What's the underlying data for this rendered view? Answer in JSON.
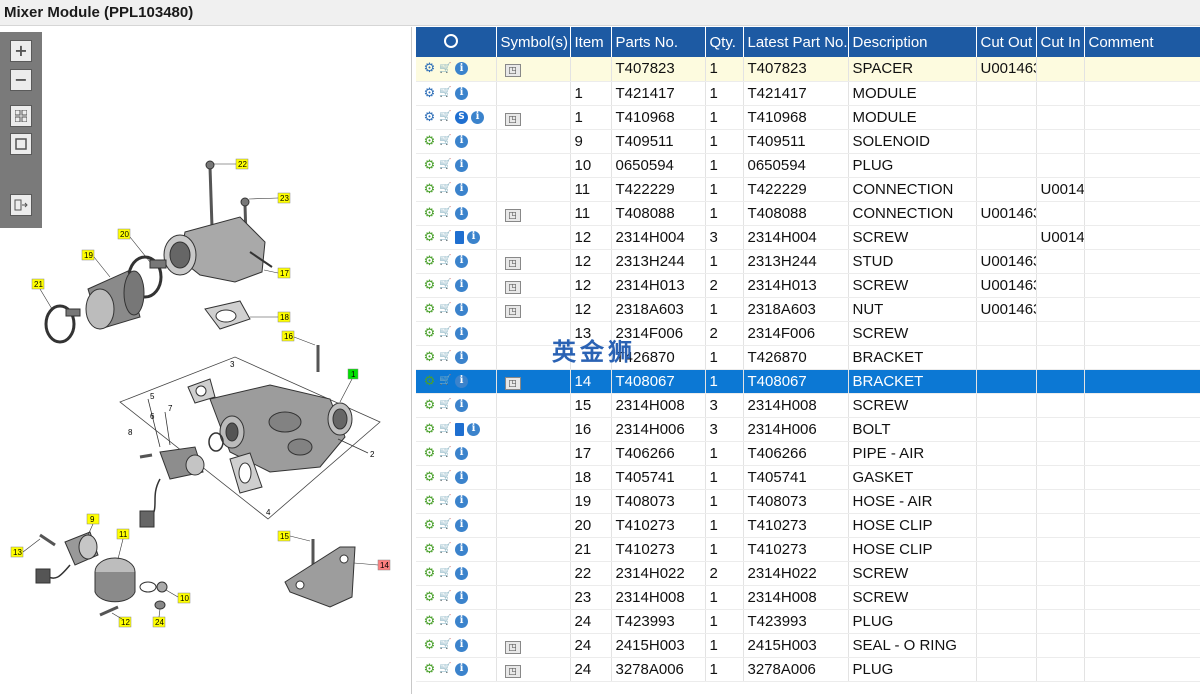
{
  "window": {
    "title": "Mixer Module (PPL103480)"
  },
  "toolbar": {
    "zoom_in_icon": "plus-icon",
    "zoom_out_icon": "minus-icon",
    "fit_icon": "grid-icon",
    "actual_icon": "square-icon",
    "export_icon": "export-icon"
  },
  "watermark": "英金狮",
  "callouts": [
    "22",
    "23",
    "20",
    "19",
    "17",
    "21",
    "18",
    "16",
    "1",
    "5",
    "7",
    "3",
    "6",
    "8",
    "2",
    "4",
    "9",
    "13",
    "11",
    "10",
    "12",
    "24",
    "15",
    "14"
  ],
  "columns": {
    "icon_header": "magnifier-icon",
    "symbols": "Symbol(s)",
    "item": "Item",
    "parts_no": "Parts No.",
    "qty": "Qty.",
    "latest_part_no": "Latest Part No.",
    "description": "Description",
    "cut_out": "Cut Out",
    "cut_in": "Cut In",
    "comment": "Comment"
  },
  "rows": [
    {
      "item": "",
      "part": "T407823",
      "qty": "1",
      "latest": "T407823",
      "desc": "SPACER",
      "cut_out": "U001463",
      "cut_in": "",
      "comment": ""
    },
    {
      "item": "1",
      "part": "T421417",
      "qty": "1",
      "latest": "T421417",
      "desc": "MODULE",
      "cut_out": "",
      "cut_in": "",
      "comment": ""
    },
    {
      "item": "1",
      "part": "T410968",
      "qty": "1",
      "latest": "T410968",
      "desc": "MODULE",
      "cut_out": "",
      "cut_in": "",
      "comment": ""
    },
    {
      "item": "9",
      "part": "T409511",
      "qty": "1",
      "latest": "T409511",
      "desc": "SOLENOID",
      "cut_out": "",
      "cut_in": "",
      "comment": ""
    },
    {
      "item": "10",
      "part": "0650594",
      "qty": "1",
      "latest": "0650594",
      "desc": "PLUG",
      "cut_out": "",
      "cut_in": "",
      "comment": ""
    },
    {
      "item": "11",
      "part": "T422229",
      "qty": "1",
      "latest": "T422229",
      "desc": "CONNECTION",
      "cut_out": "",
      "cut_in": "U0014",
      "comment": ""
    },
    {
      "item": "11",
      "part": "T408088",
      "qty": "1",
      "latest": "T408088",
      "desc": "CONNECTION",
      "cut_out": "U001463",
      "cut_in": "",
      "comment": ""
    },
    {
      "item": "12",
      "part": "2314H004",
      "qty": "3",
      "latest": "2314H004",
      "desc": "SCREW",
      "cut_out": "",
      "cut_in": "U0014",
      "comment": ""
    },
    {
      "item": "12",
      "part": "2313H244",
      "qty": "1",
      "latest": "2313H244",
      "desc": "STUD",
      "cut_out": "U001463",
      "cut_in": "",
      "comment": ""
    },
    {
      "item": "12",
      "part": "2314H013",
      "qty": "2",
      "latest": "2314H013",
      "desc": "SCREW",
      "cut_out": "U001463",
      "cut_in": "",
      "comment": ""
    },
    {
      "item": "12",
      "part": "2318A603",
      "qty": "1",
      "latest": "2318A603",
      "desc": "NUT",
      "cut_out": "U001463",
      "cut_in": "",
      "comment": ""
    },
    {
      "item": "13",
      "part": "2314F006",
      "qty": "2",
      "latest": "2314F006",
      "desc": "SCREW",
      "cut_out": "",
      "cut_in": "",
      "comment": ""
    },
    {
      "item": "",
      "part": "T426870",
      "qty": "1",
      "latest": "T426870",
      "desc": "BRACKET",
      "cut_out": "",
      "cut_in": "",
      "comment": ""
    },
    {
      "item": "14",
      "part": "T408067",
      "qty": "1",
      "latest": "T408067",
      "desc": "BRACKET",
      "cut_out": "",
      "cut_in": "",
      "comment": ""
    },
    {
      "item": "15",
      "part": "2314H008",
      "qty": "3",
      "latest": "2314H008",
      "desc": "SCREW",
      "cut_out": "",
      "cut_in": "",
      "comment": ""
    },
    {
      "item": "16",
      "part": "2314H006",
      "qty": "3",
      "latest": "2314H006",
      "desc": "BOLT",
      "cut_out": "",
      "cut_in": "",
      "comment": ""
    },
    {
      "item": "17",
      "part": "T406266",
      "qty": "1",
      "latest": "T406266",
      "desc": "PIPE - AIR",
      "cut_out": "",
      "cut_in": "",
      "comment": ""
    },
    {
      "item": "18",
      "part": "T405741",
      "qty": "1",
      "latest": "T405741",
      "desc": "GASKET",
      "cut_out": "",
      "cut_in": "",
      "comment": ""
    },
    {
      "item": "19",
      "part": "T408073",
      "qty": "1",
      "latest": "T408073",
      "desc": "HOSE - AIR",
      "cut_out": "",
      "cut_in": "",
      "comment": ""
    },
    {
      "item": "20",
      "part": "T410273",
      "qty": "1",
      "latest": "T410273",
      "desc": "HOSE CLIP",
      "cut_out": "",
      "cut_in": "",
      "comment": ""
    },
    {
      "item": "21",
      "part": "T410273",
      "qty": "1",
      "latest": "T410273",
      "desc": "HOSE CLIP",
      "cut_out": "",
      "cut_in": "",
      "comment": ""
    },
    {
      "item": "22",
      "part": "2314H022",
      "qty": "2",
      "latest": "2314H022",
      "desc": "SCREW",
      "cut_out": "",
      "cut_in": "",
      "comment": ""
    },
    {
      "item": "23",
      "part": "2314H008",
      "qty": "1",
      "latest": "2314H008",
      "desc": "SCREW",
      "cut_out": "",
      "cut_in": "",
      "comment": ""
    },
    {
      "item": "24",
      "part": "T423993",
      "qty": "1",
      "latest": "T423993",
      "desc": "PLUG",
      "cut_out": "",
      "cut_in": "",
      "comment": ""
    },
    {
      "item": "24",
      "part": "2415H003",
      "qty": "1",
      "latest": "2415H003",
      "desc": "SEAL - O RING",
      "cut_out": "",
      "cut_in": "",
      "comment": ""
    },
    {
      "item": "24",
      "part": "3278A006",
      "qty": "1",
      "latest": "3278A006",
      "desc": "PLUG",
      "cut_out": "",
      "cut_in": "",
      "comment": ""
    }
  ],
  "colors": {
    "header_bg": "#1d5aa3",
    "selected_bg": "#0c78d4",
    "highlight_row": "#fdfbdf",
    "callout_yellow": "#ffff00",
    "callout_selected": "#ff7f7f",
    "callout_green": "#00e000"
  }
}
